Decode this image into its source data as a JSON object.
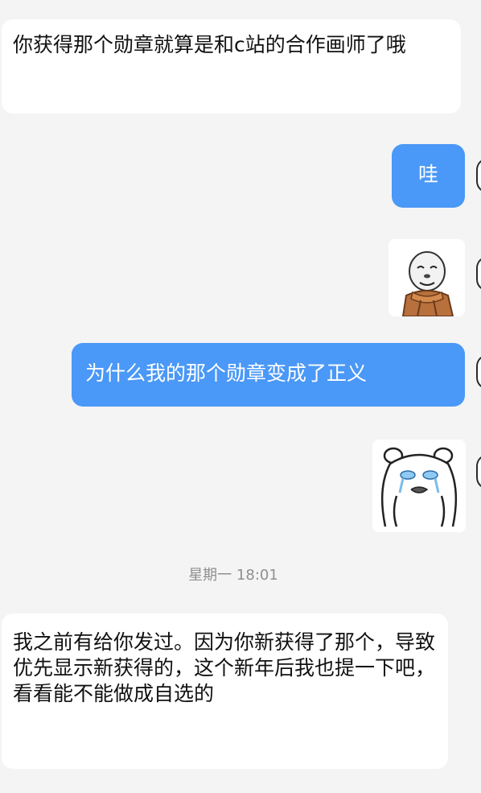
{
  "messages": [
    {
      "side": "received",
      "text": "你获得那个勋章就算是和c站的合作画师了哦"
    },
    {
      "side": "sent",
      "text": "哇"
    },
    {
      "side": "sent",
      "sticker": "doge-meme-face-scarf-sticker"
    },
    {
      "side": "sent",
      "text": "为什么我的那个勋章变成了正义"
    },
    {
      "side": "sent",
      "sticker": "crying-bear-sticker"
    },
    {
      "side": "received",
      "text": "我之前有给你发过。因为你新获得了那个，导致优先显示新获得的，这个新年后我也提一下吧，看看能不能做成自选的"
    }
  ],
  "divider": {
    "timestamp": "星期一 18:01"
  },
  "colors": {
    "background": "#f4f4f4",
    "received_bubble": "#ffffff",
    "sent_bubble": "#4a98f7"
  }
}
